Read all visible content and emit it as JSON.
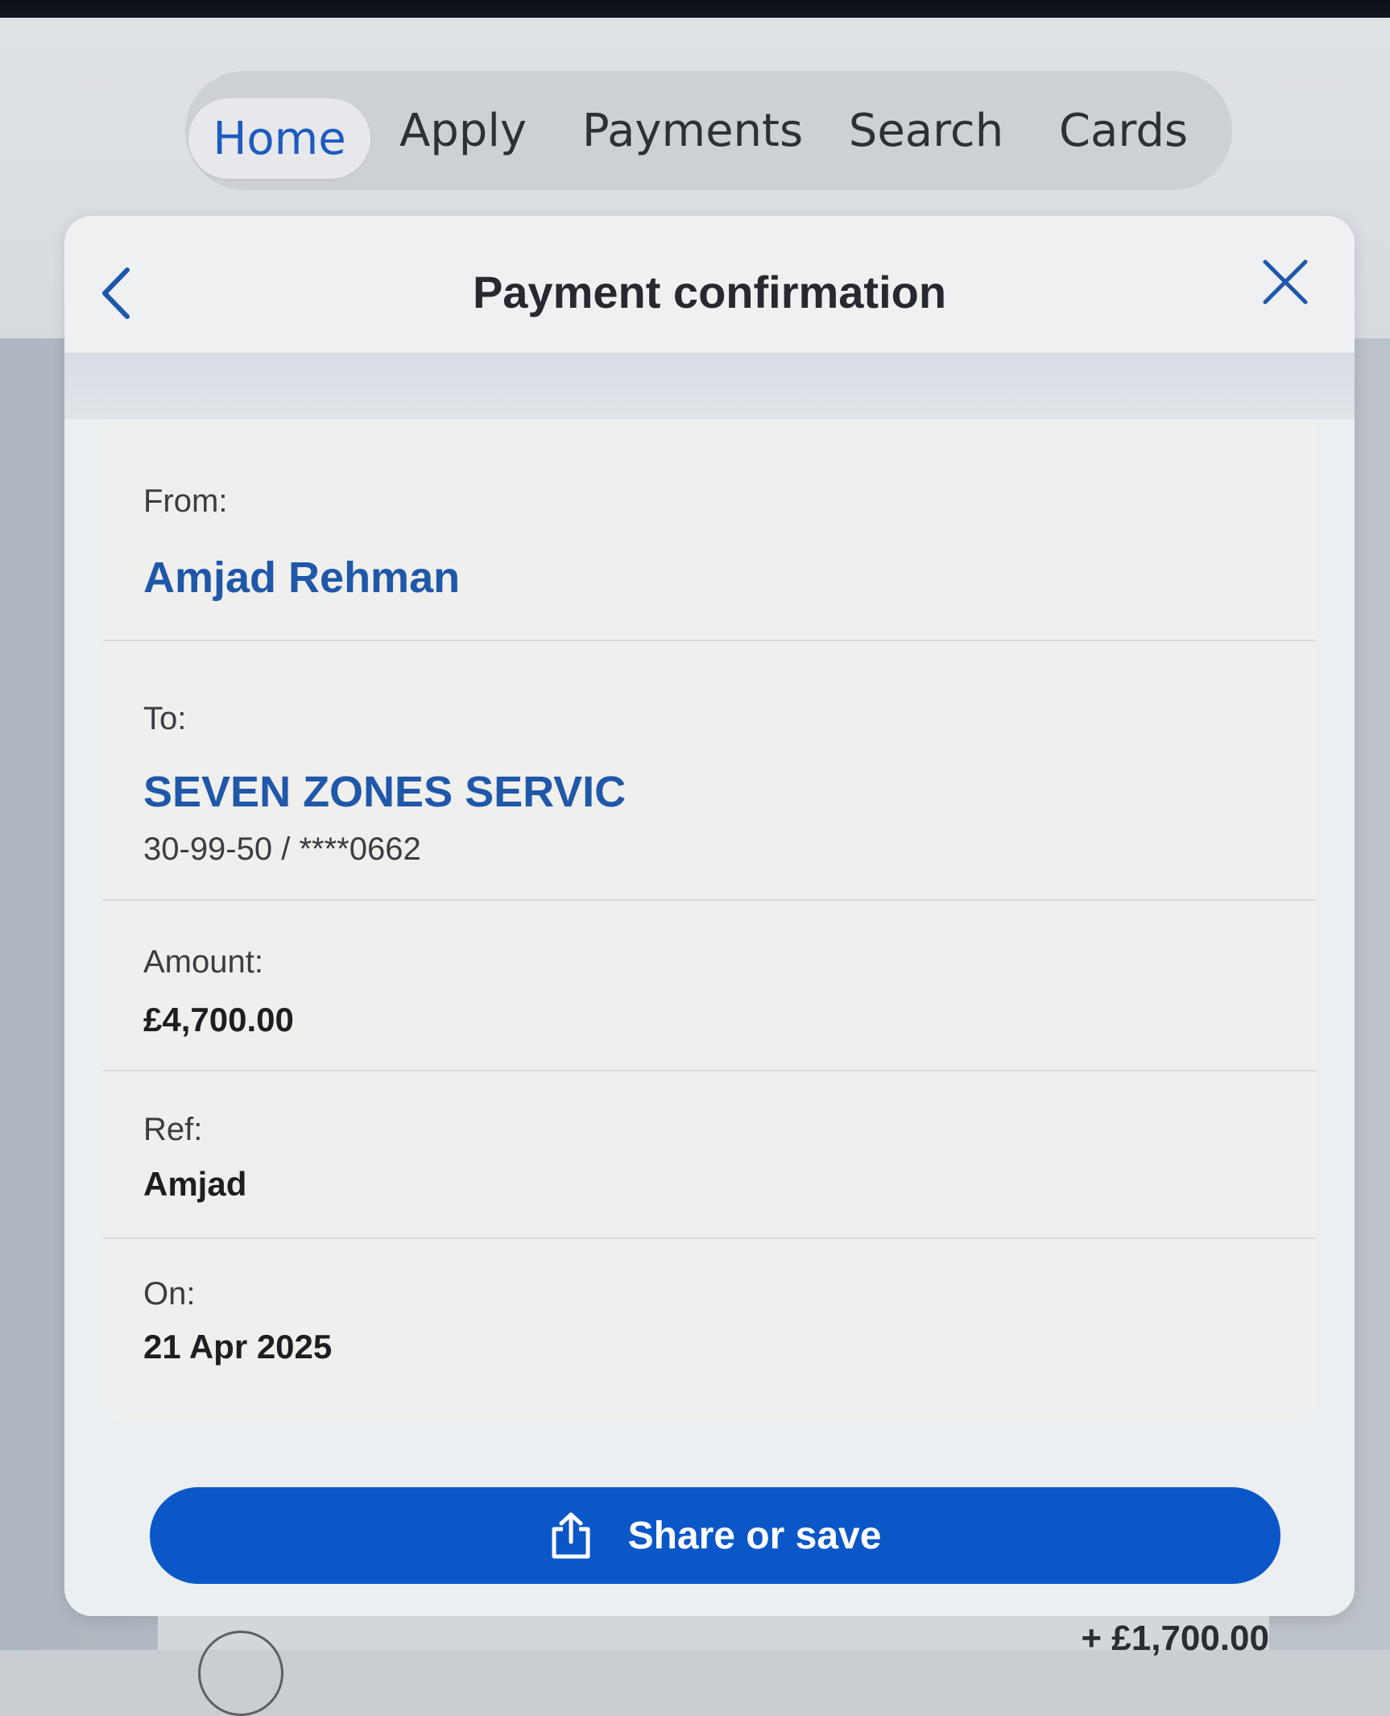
{
  "nav": {
    "tabs": [
      {
        "label": "Home",
        "active": true
      },
      {
        "label": "Apply",
        "active": false
      },
      {
        "label": "Payments",
        "active": false
      },
      {
        "label": "Search",
        "active": false
      },
      {
        "label": "Cards",
        "active": false
      }
    ]
  },
  "modal": {
    "title": "Payment confirmation",
    "back_icon": "chevron-left-icon",
    "close_icon": "close-icon"
  },
  "details": {
    "from_label": "From:",
    "from_name": "Amjad Rehman",
    "to_label": "To:",
    "to_name": "SEVEN ZONES SERVIC",
    "to_account": "30-99-50 / ****0662",
    "amount_label": "Amount:",
    "amount_value": "£4,700.00",
    "ref_label": "Ref:",
    "ref_value": "Amjad",
    "on_label": "On:",
    "on_value": "21 Apr 2025"
  },
  "actions": {
    "share_label": "Share or save",
    "share_icon": "share-icon"
  },
  "background": {
    "peek_amount": "+ £1,700.00"
  },
  "colors": {
    "accent": "#0b57c8",
    "name_blue": "#1f57a9",
    "active_tab": "#1d5bbf"
  }
}
